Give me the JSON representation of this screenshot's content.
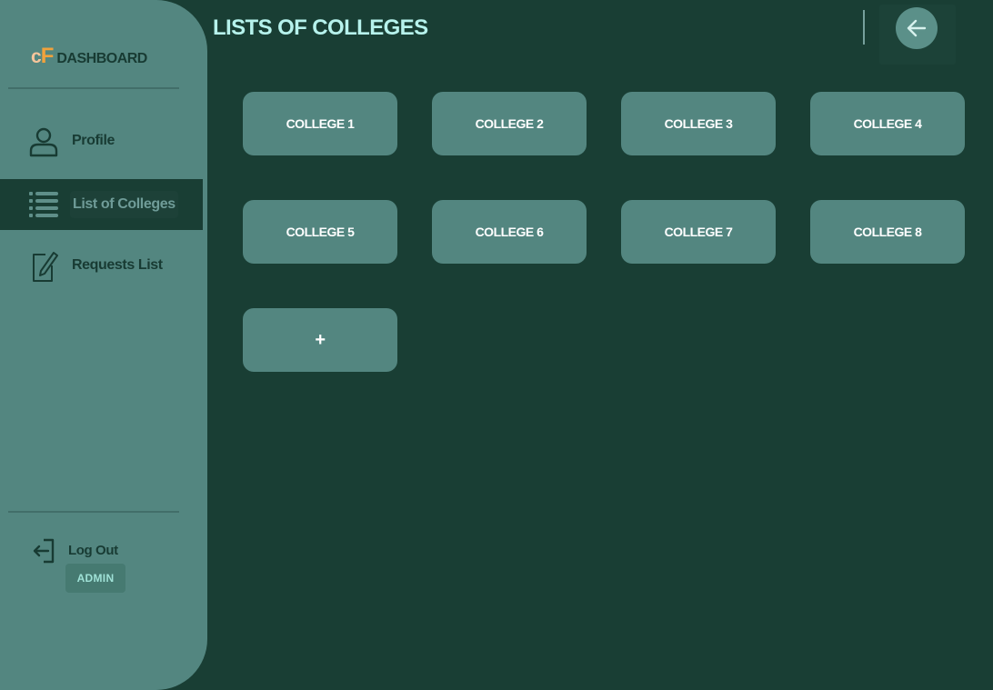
{
  "brand": {
    "logo_c": "c",
    "logo_f": "F",
    "title": "DASHBOARD"
  },
  "sidebar": {
    "items": [
      {
        "label": "Profile",
        "icon": "user-icon"
      },
      {
        "label": "List of Colleges",
        "icon": "list-icon",
        "active": true
      },
      {
        "label": "Requests List",
        "icon": "edit-note-icon"
      }
    ],
    "logout_label": "Log Out",
    "role": "ADMIN"
  },
  "header": {
    "title": "LISTS OF COLLEGES",
    "back_icon": "arrow-left-icon"
  },
  "colleges": [
    "COLLEGE 1",
    "COLLEGE 2",
    "COLLEGE 3",
    "COLLEGE 4",
    "COLLEGE 5",
    "COLLEGE 6",
    "COLLEGE 7",
    "COLLEGE 8"
  ],
  "add_button_label": "+",
  "colors": {
    "background": "#193e34",
    "sidebar": "#538680",
    "card": "#538680",
    "title": "#b6f2ec",
    "logo_orange": "#f0a23c"
  }
}
